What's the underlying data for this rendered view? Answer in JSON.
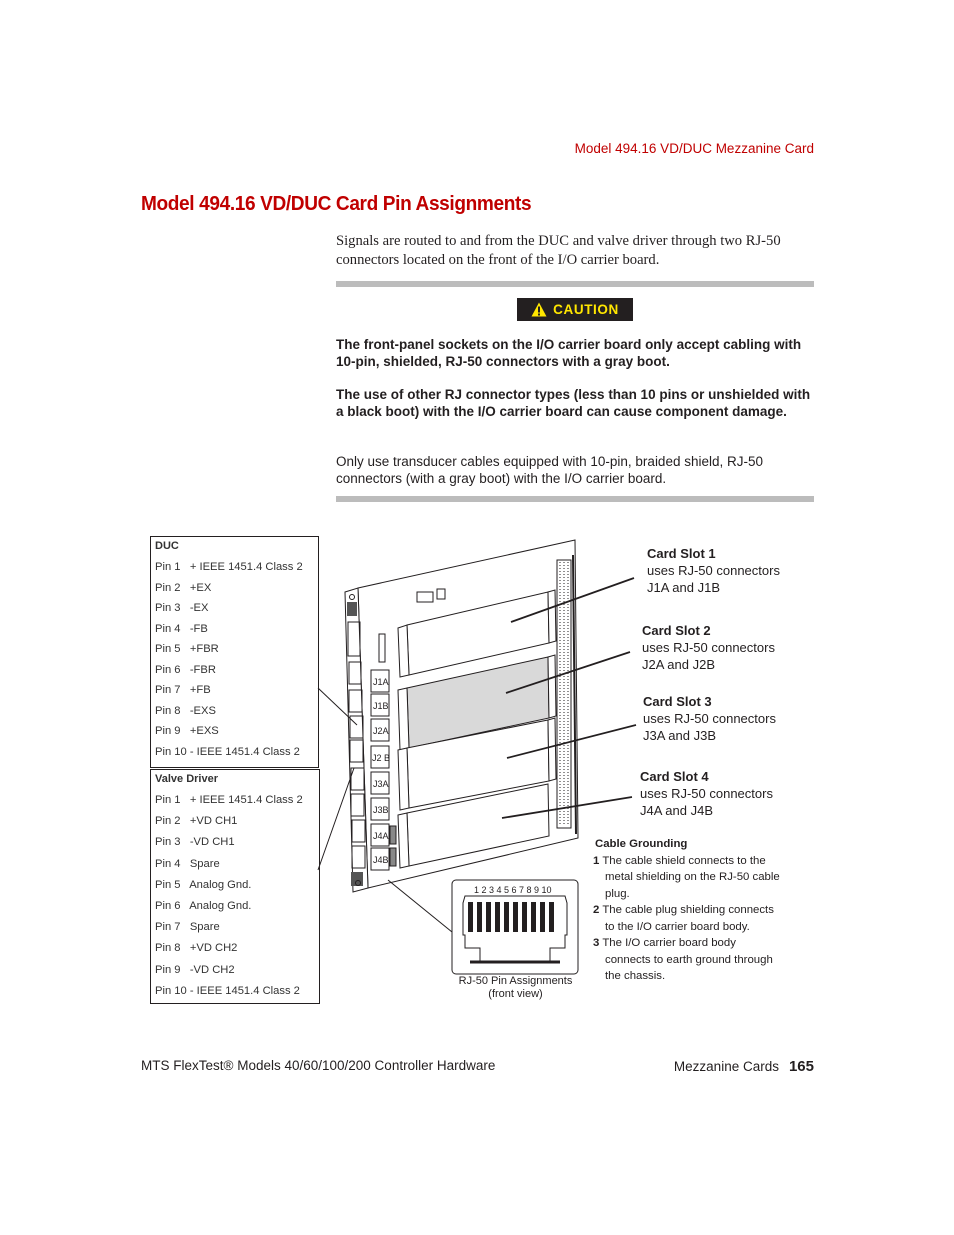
{
  "header": {
    "running_head": "Model 494.16 VD/DUC Mezzanine Card",
    "section_title": "Model 494.16 VD/DUC Card Pin Assignments"
  },
  "intro": "Signals are routed to and from the DUC and valve driver through two RJ-50 connectors located on the front of the I/O carrier board.",
  "caution": {
    "badge_label": "CAUTION",
    "icon": "warning-triangle-icon",
    "colors": {
      "badge_bg": "#231f20",
      "badge_text": "#ffe600"
    },
    "paragraphs": [
      {
        "text": "The front-panel sockets on the I/O carrier board only accept cabling with 10-pin, shielded, RJ-50 connectors with a gray boot.",
        "bold": true
      },
      {
        "text": "The use of other RJ connector types (less than 10 pins or unshielded with a black boot) with the I/O carrier board can cause component damage.",
        "bold": true
      },
      {
        "text": "Only use transducer cables equipped with 10-pin, braided shield, RJ-50 connectors (with a gray boot) with the I/O carrier board.",
        "bold": false
      }
    ]
  },
  "figure": {
    "duc_table": {
      "title": "DUC",
      "rows": [
        "Pin 1   + IEEE 1451.4 Class 2",
        "Pin 2   +EX",
        "Pin 3   -EX",
        "Pin 4   -FB",
        "Pin 5   +FBR",
        "Pin 6   -FBR",
        "Pin 7   +FB",
        "Pin 8   -EXS",
        "Pin 9   +EXS",
        "Pin 10 - IEEE 1451.4 Class 2"
      ]
    },
    "valve_driver_table": {
      "title": "Valve Driver",
      "rows": [
        "Pin 1   + IEEE 1451.4 Class 2",
        "Pin 2   +VD CH1",
        "Pin 3   -VD CH1",
        "Pin 4   Spare",
        "Pin 5   Analog Gnd.",
        "Pin 6   Analog Gnd.",
        "Pin 7   Spare",
        "Pin 8   +VD CH2",
        "Pin 9   -VD CH2",
        "Pin 10 - IEEE 1451.4 Class 2"
      ]
    },
    "connector_labels": [
      "J1A",
      "J1B",
      "J2A",
      "J2 B",
      "J3A",
      "J3B",
      "J4A",
      "J4B"
    ],
    "card_slots": [
      {
        "title": "Card Slot 1",
        "line1": "uses RJ-50 connectors",
        "line2": "J1A and J1B"
      },
      {
        "title": "Card Slot 2",
        "line1": "uses RJ-50 connectors",
        "line2": "J2A and J2B"
      },
      {
        "title": "Card Slot 3",
        "line1": "uses RJ-50 connectors",
        "line2": "J3A and J3B"
      },
      {
        "title": "Card Slot 4",
        "line1": "uses RJ-50 connectors",
        "line2": "J4A and J4B"
      }
    ],
    "highlighted_slot": 2,
    "rj50": {
      "pin_numbers": "1 2 3 4 5 6 7 8 9 10",
      "caption_line1": "RJ-50 Pin Assignments",
      "caption_line2": "(front view)"
    },
    "cable_grounding": {
      "title": "Cable Grounding",
      "items": [
        {
          "num": "1",
          "text": "The cable shield connects to the metal shielding on the RJ-50 cable plug."
        },
        {
          "num": "2",
          "text": "The cable plug shielding connects to the I/O carrier board body."
        },
        {
          "num": "3",
          "text": "The I/O carrier board body connects to earth ground through the chassis."
        }
      ]
    }
  },
  "footer": {
    "left": "MTS FlexTest® Models 40/60/100/200 Controller Hardware",
    "chapter": "Mezzanine Cards",
    "page_number": "165"
  }
}
